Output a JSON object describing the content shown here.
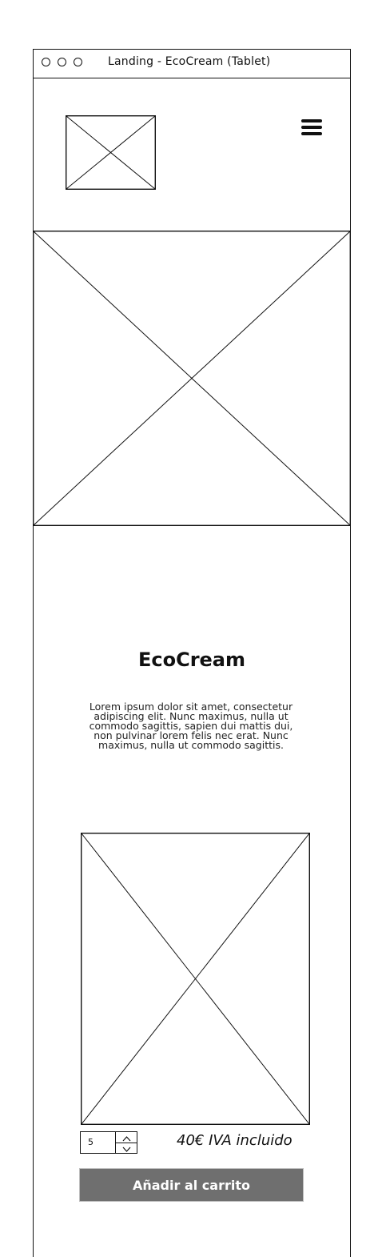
{
  "window": {
    "title": "Landing - EcoCream (Tablet)"
  },
  "hero": {
    "title": "EcoCream",
    "body": "Lorem ipsum dolor sit amet, consectetur adipiscing elit. Nunc maximus, nulla ut commodo sagittis, sapien dui mattis dui, non pulvinar lorem felis nec erat. Nunc maximus, nulla ut commodo sagittis."
  },
  "purchase": {
    "quantity": "5",
    "price": "40€ IVA incluido",
    "add_to_cart_label": "Añadir al carrito"
  },
  "icons": {
    "menu": "hamburger-menu-icon",
    "logo": "image-placeholder",
    "qty_up": "chevron-up-icon",
    "qty_down": "chevron-down-icon"
  },
  "colors": {
    "cta_background": "#6f6f6f",
    "cta_text": "#ffffff",
    "stroke": "#111111"
  }
}
